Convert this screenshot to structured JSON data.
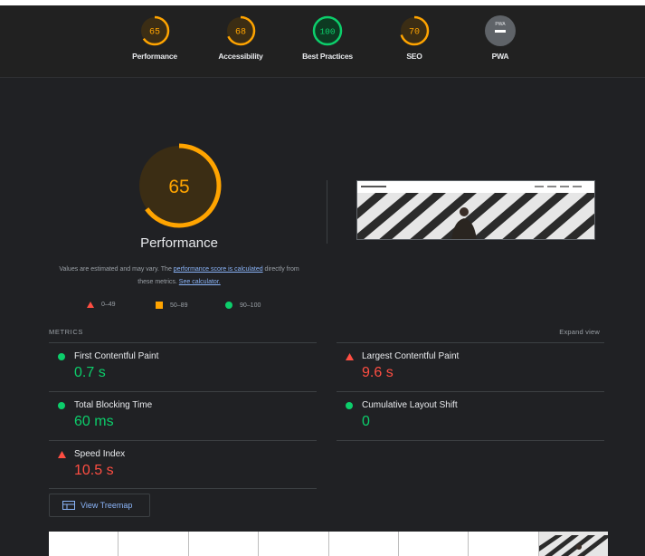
{
  "categories": [
    {
      "label": "Performance",
      "score": "65",
      "color": "#ffa400"
    },
    {
      "label": "Accessibility",
      "score": "68",
      "color": "#ffa400"
    },
    {
      "label": "Best Practices",
      "score": "100",
      "color": "#0cce6b"
    },
    {
      "label": "SEO",
      "score": "70",
      "color": "#ffa400"
    },
    {
      "label": "PWA",
      "badge": "PWA",
      "icon": "pwa-dash-icon"
    }
  ],
  "performance": {
    "score": "65",
    "title": "Performance",
    "note_prefix": "Values are estimated and may vary. The ",
    "note_link": "performance score is calculated",
    "note_middle": " directly from these metrics. ",
    "note_link2": "See calculator."
  },
  "legend": [
    {
      "range": "0–49",
      "icon": "red-triangle-icon"
    },
    {
      "range": "50–89",
      "icon": "orange-square-icon"
    },
    {
      "range": "90–100",
      "icon": "green-circle-icon"
    }
  ],
  "metrics": {
    "heading": "METRICS",
    "expand_label": "Expand view",
    "items": [
      {
        "name": "First Contentful Paint",
        "value": "0.7 s",
        "status": "pass"
      },
      {
        "name": "Largest Contentful Paint",
        "value": "9.6 s",
        "status": "fail"
      },
      {
        "name": "Total Blocking Time",
        "value": "60 ms",
        "status": "pass"
      },
      {
        "name": "Cumulative Layout Shift",
        "value": "0",
        "status": "pass"
      },
      {
        "name": "Speed Index",
        "value": "10.5 s",
        "status": "fail"
      }
    ]
  },
  "treemap": {
    "label": "View Treemap"
  },
  "colors": {
    "pass": "#0cce6b",
    "average": "#ffa400",
    "fail": "#ff4e42",
    "link": "#8ab4f8",
    "background": "#202124"
  }
}
